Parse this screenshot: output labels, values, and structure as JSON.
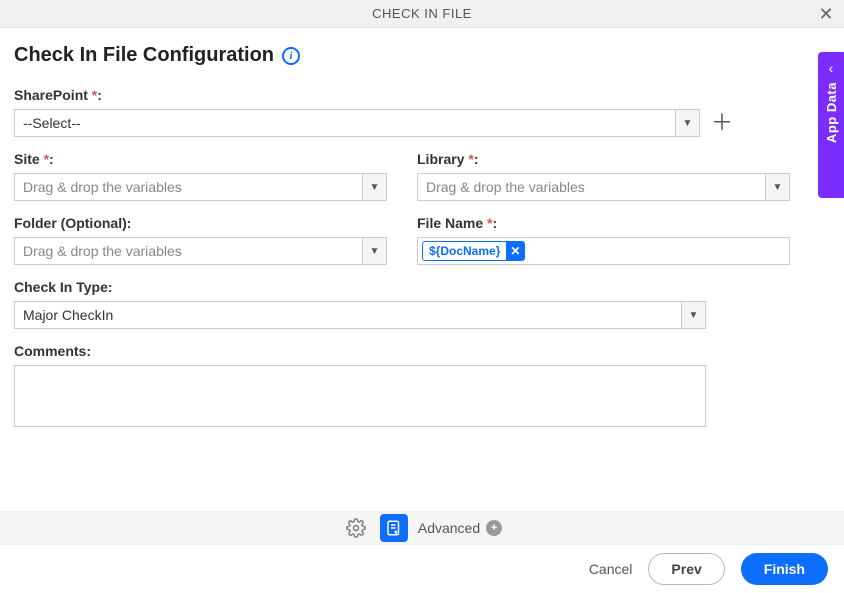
{
  "header": {
    "title": "CHECK IN FILE"
  },
  "page": {
    "title": "Check In File Configuration"
  },
  "sideTab": {
    "label": "App Data"
  },
  "fields": {
    "sharepoint": {
      "label": "SharePoint",
      "required": "*",
      "value": "--Select--"
    },
    "site": {
      "label": "Site",
      "required": "*",
      "placeholder": "Drag & drop the variables"
    },
    "library": {
      "label": "Library",
      "required": "*",
      "placeholder": "Drag & drop the variables"
    },
    "folder": {
      "label": "Folder (Optional):",
      "placeholder": "Drag & drop the variables"
    },
    "filename": {
      "label": "File Name",
      "required": "*",
      "tag": "${DocName}"
    },
    "checkintype": {
      "label": "Check In Type:",
      "value": "Major CheckIn"
    },
    "comments": {
      "label": "Comments:"
    }
  },
  "toolbar": {
    "advanced": "Advanced"
  },
  "footer": {
    "cancel": "Cancel",
    "prev": "Prev",
    "finish": "Finish"
  }
}
